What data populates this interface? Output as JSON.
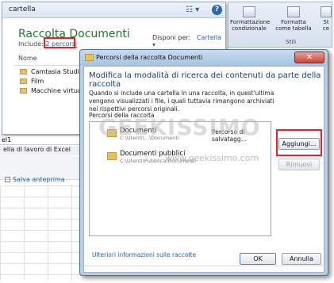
{
  "explorer": {
    "path_text": "cartella",
    "library_title": "Raccolta Documenti",
    "include_label": "Include:",
    "include_link": "2 percorsi",
    "arrange_label": "Disponi per:",
    "arrange_value": "Cartella",
    "column_name": "Nome",
    "files": [
      "Camtasia Studio",
      "Film",
      "Macchine virtuali"
    ]
  },
  "lower_left": {
    "strip1": "el1",
    "strip2": "ella di lavoro di Excel",
    "save_preview": "Salva anteprima"
  },
  "ribbon": {
    "buttons": [
      {
        "label1": "Formattazione",
        "label2": "condizionale"
      },
      {
        "label1": "Formatta",
        "label2": "come tabella"
      },
      {
        "label1": "St",
        "label2": "ce"
      }
    ],
    "group": "Stili"
  },
  "dialog": {
    "title": "Percorsi della raccolta Documenti",
    "close": "✕",
    "heading": "Modifica la modalità di ricerca dei contenuti da parte della raccolta",
    "description": "Quando si include una cartella in una raccolta, in quest'ultima vengono visualizzati i file, i quali tuttavia rimangono archiviati nei rispettivi percorsi originali.",
    "list_label": "Percorsi della raccolta",
    "entries": [
      {
        "name": "Documenti",
        "path": "C:\\Utenti\\...\\Documenti",
        "save": "Percorso di salvatagg..."
      },
      {
        "name": "Documenti pubblici",
        "path": "C:\\Utenti\\Pubblica\\Documenti"
      }
    ],
    "add_button": "Aggiungi...",
    "remove_button": "Rimuovi",
    "more_info": "Ulteriori informazioni sulle raccolte",
    "ok": "OK",
    "cancel": "Annulla"
  },
  "watermark": {
    "text": "GEEKISSIMO",
    "sub": "www.geekissimo.com"
  }
}
